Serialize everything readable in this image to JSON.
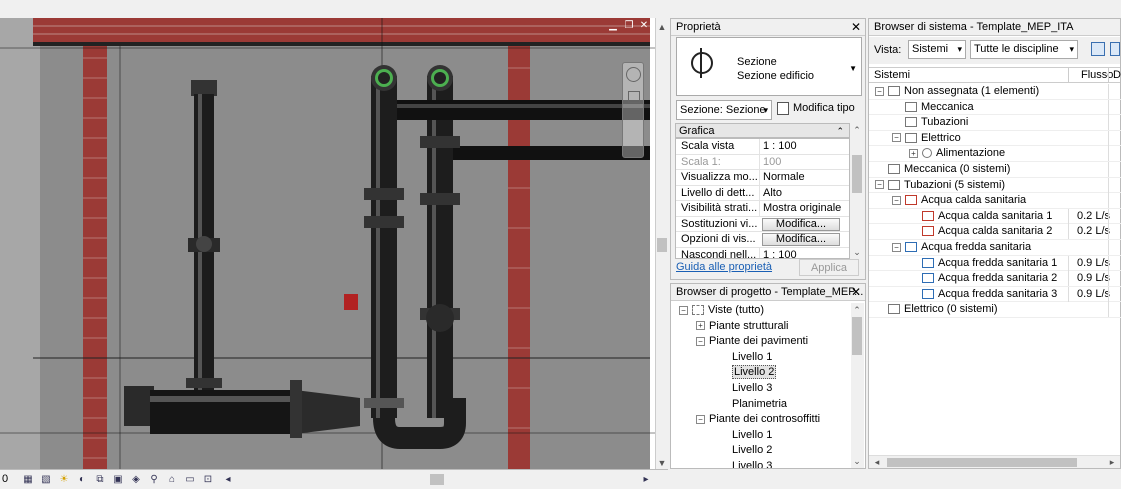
{
  "properties": {
    "title": "Proprietà",
    "close": "✕",
    "type_line1": "Sezione",
    "type_line2": "Sezione edificio",
    "selector": "Sezione: Sezione",
    "edit_type": "Modifica tipo",
    "group": "Grafica",
    "rows": [
      {
        "k": "Scala vista",
        "v": "1 : 100"
      },
      {
        "k": "Scala  1:",
        "v": "100"
      },
      {
        "k": "Visualizza mo...",
        "v": "Normale"
      },
      {
        "k": "Livello di dett...",
        "v": "Alto"
      },
      {
        "k": "Visibilità strati...",
        "v": "Mostra originale"
      },
      {
        "k": "Sostituzioni vi...",
        "v": "Modifica..."
      },
      {
        "k": "Opzioni di vis...",
        "v": "Modifica..."
      },
      {
        "k": "Nascondi nell...",
        "v": "1 : 100"
      }
    ],
    "help_link": "Guida alle proprietà",
    "apply": "Applica"
  },
  "project_browser": {
    "title": "Browser di progetto - Template_MEP...",
    "close": "✕",
    "items": [
      {
        "label": "Viste (tutto)",
        "level": 0,
        "exp": "−"
      },
      {
        "label": "Piante strutturali",
        "level": 1,
        "exp": "+"
      },
      {
        "label": "Piante dei pavimenti",
        "level": 1,
        "exp": "−"
      },
      {
        "label": "Livello 1",
        "level": 2
      },
      {
        "label": "Livello 2",
        "level": 2,
        "selected": true
      },
      {
        "label": "Livello 3",
        "level": 2
      },
      {
        "label": "Planimetria",
        "level": 2
      },
      {
        "label": "Piante dei controsoffitti",
        "level": 1,
        "exp": "−"
      },
      {
        "label": "Livello 1",
        "level": 2
      },
      {
        "label": "Livello 2",
        "level": 2
      },
      {
        "label": "Livello 3",
        "level": 2
      }
    ]
  },
  "system_browser": {
    "title": "Browser di sistema - Template_MEP_ITA",
    "view_label": "Vista:",
    "view_value": "Sistemi",
    "discipline_value": "Tutte le discipline",
    "col_systems": "Sistemi",
    "col_flow": "Flusso",
    "col_d": "D",
    "rows": [
      {
        "label": "Non assegnata (1 elementi)",
        "level": 0,
        "exp": "−",
        "flow": ""
      },
      {
        "label": "Meccanica",
        "level": 1,
        "flow": ""
      },
      {
        "label": "Tubazioni",
        "level": 1,
        "flow": ""
      },
      {
        "label": "Elettrico",
        "level": 1,
        "exp": "−",
        "flow": ""
      },
      {
        "label": "Alimentazione",
        "level": 2,
        "exp": "+",
        "flow": ""
      },
      {
        "label": "Meccanica (0 sistemi)",
        "level": 0,
        "flow": ""
      },
      {
        "label": "Tubazioni (5 sistemi)",
        "level": 0,
        "exp": "−",
        "flow": ""
      },
      {
        "label": "Acqua calda sanitaria",
        "level": 1,
        "exp": "−",
        "flow": ""
      },
      {
        "label": "Acqua calda sanitaria 1",
        "level": 2,
        "flow": "0.2 L/s"
      },
      {
        "label": "Acqua calda sanitaria 2",
        "level": 2,
        "flow": "0.2 L/s"
      },
      {
        "label": "Acqua fredda sanitaria",
        "level": 1,
        "exp": "−",
        "flow": ""
      },
      {
        "label": "Acqua fredda sanitaria 1",
        "level": 2,
        "flow": "0.9 L/s"
      },
      {
        "label": "Acqua fredda sanitaria 2",
        "level": 2,
        "flow": "0.9 L/s"
      },
      {
        "label": "Acqua fredda sanitaria 3",
        "level": 2,
        "flow": "0.9 L/s"
      },
      {
        "label": "Elettrico (0 sistemi)",
        "level": 0,
        "flow": ""
      }
    ]
  },
  "statusbar": {
    "scale_prefix": "0"
  },
  "viewport_buttons": {
    "minimize": "▁",
    "restore": "❐",
    "close": "✕"
  }
}
